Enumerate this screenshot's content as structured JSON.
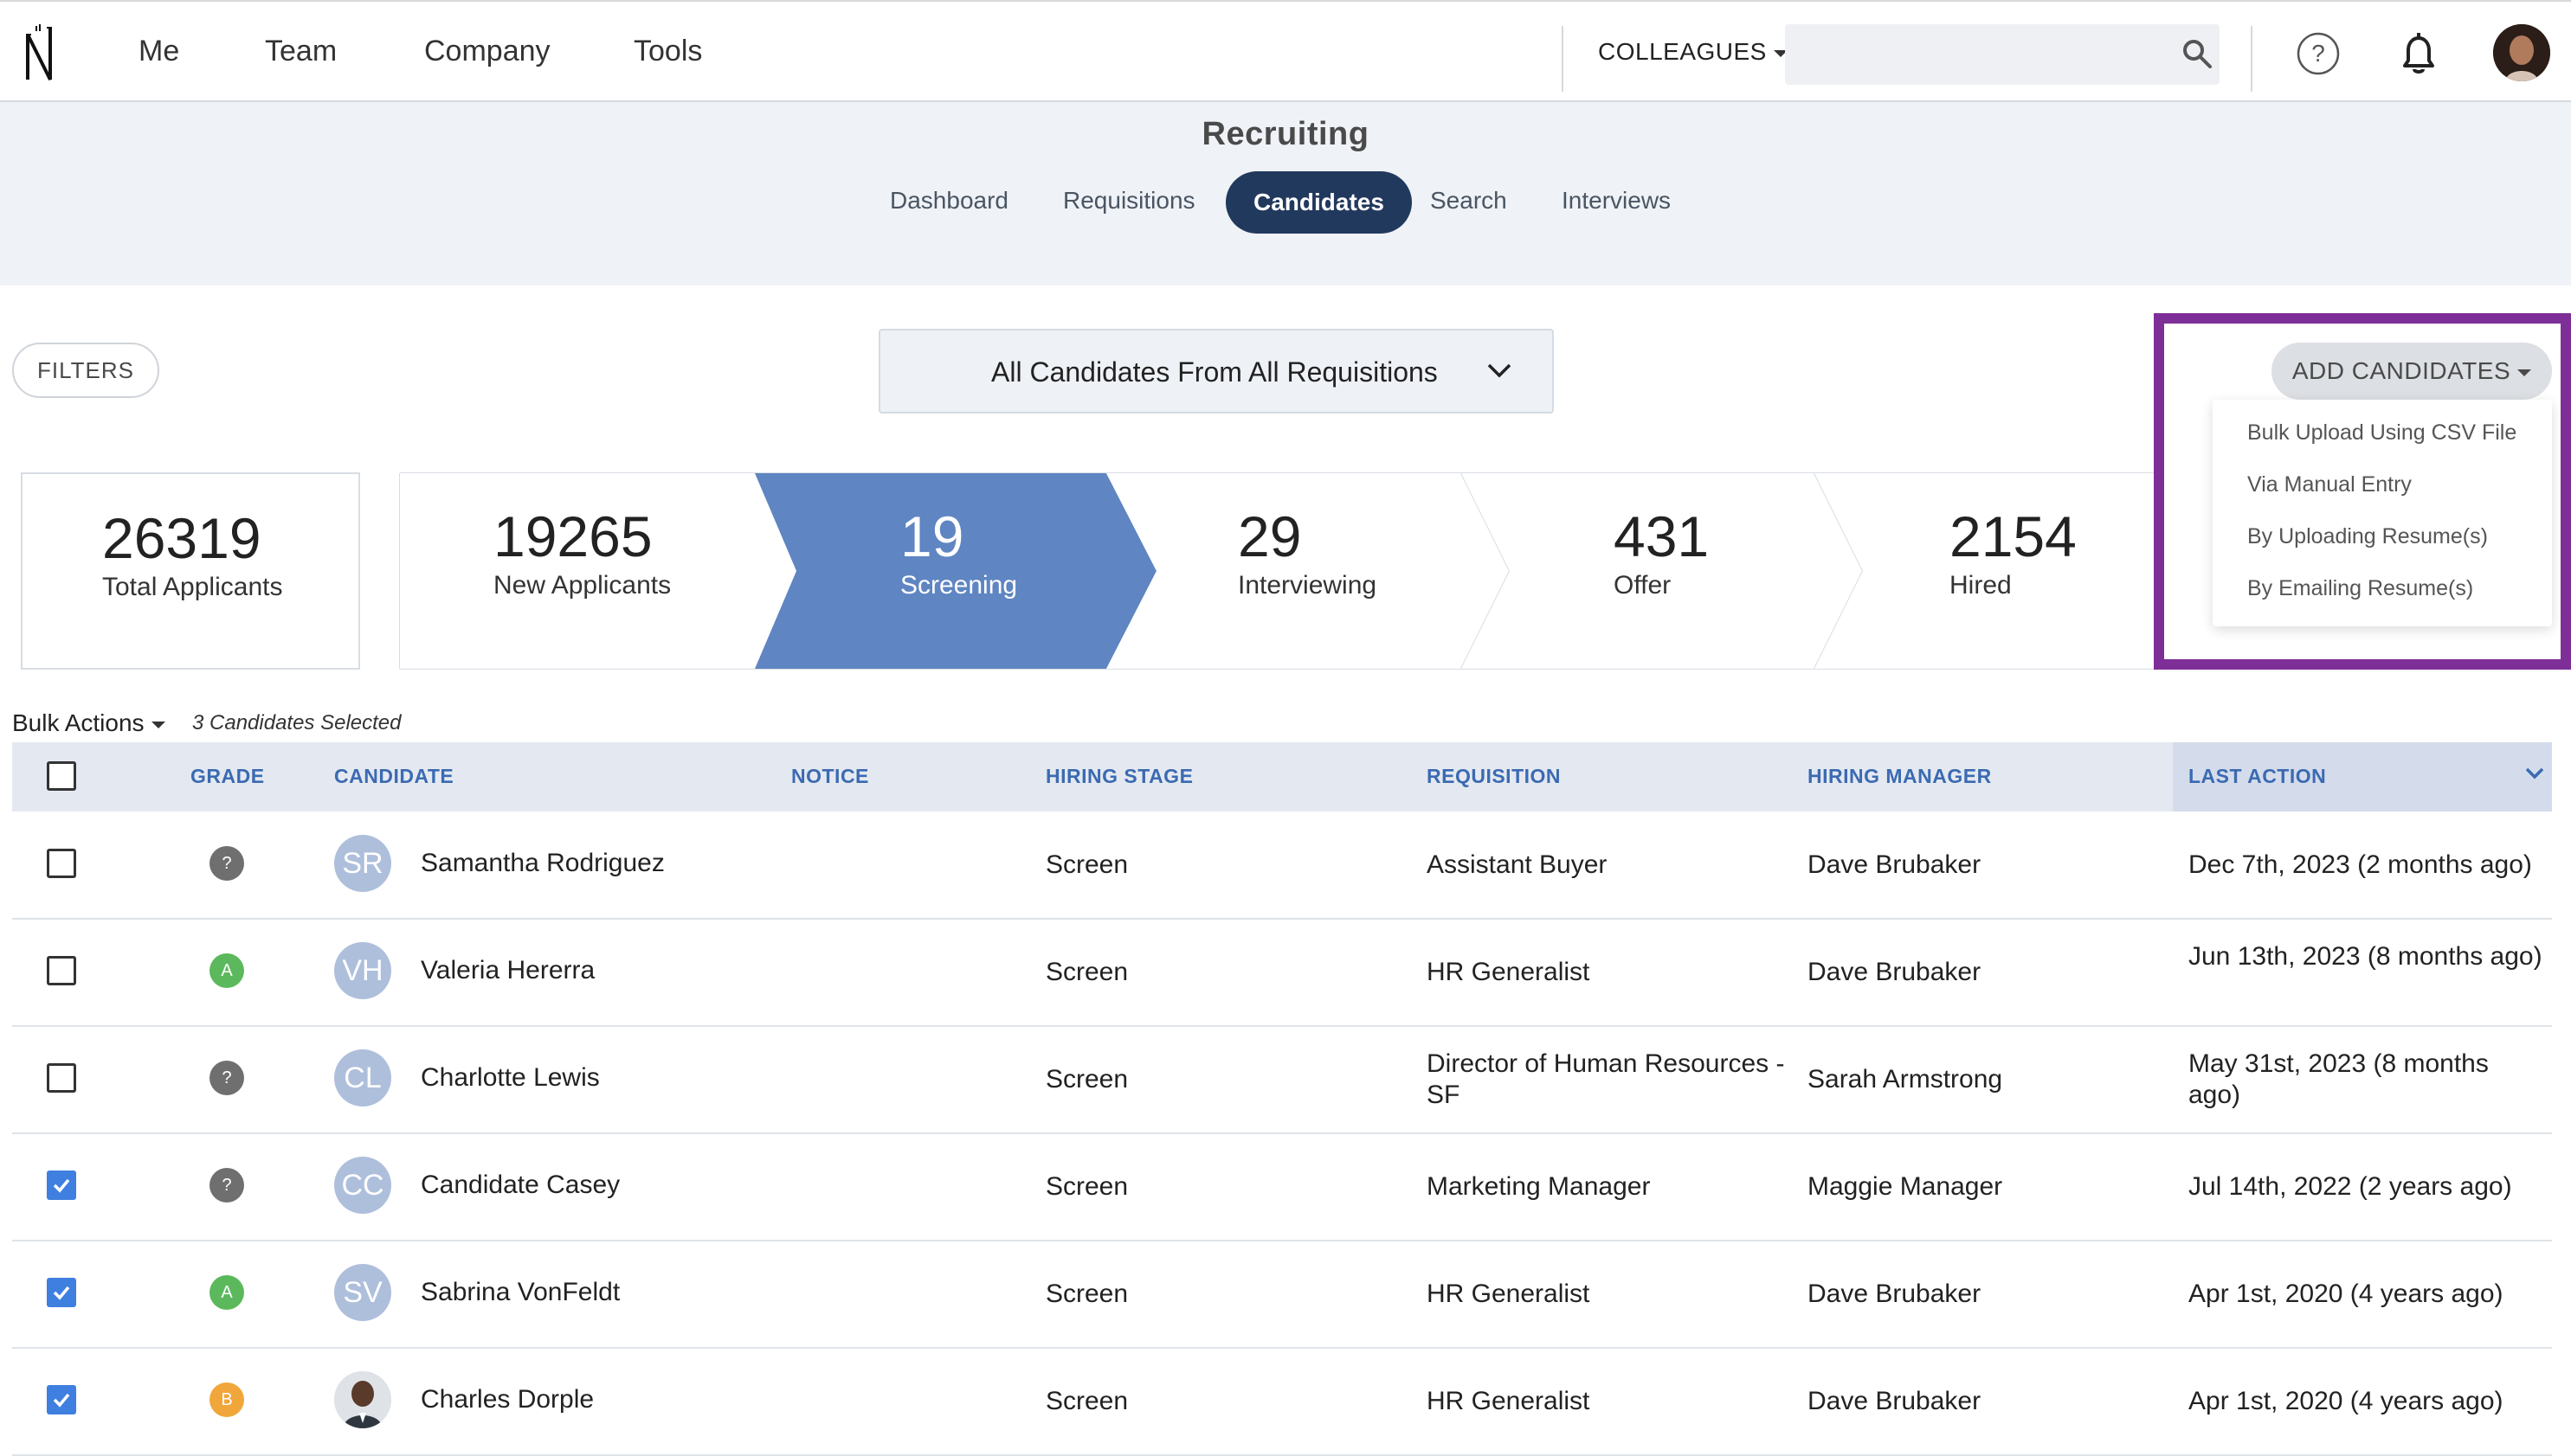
{
  "topnav": {
    "links": [
      "Me",
      "Team",
      "Company",
      "Tools"
    ],
    "colleagues_label": "COLLEAGUES",
    "search_placeholder": "",
    "help_glyph": "?"
  },
  "subnav": {
    "title": "Recruiting",
    "tabs": [
      {
        "label": "Dashboard"
      },
      {
        "label": "Requisitions"
      },
      {
        "label": "Candidates",
        "active": true
      },
      {
        "label": "Search"
      },
      {
        "label": "Interviews"
      }
    ]
  },
  "toolbar": {
    "filters_label": "FILTERS",
    "requisition_select": "All Candidates From All Requisitions",
    "add_candidates_label": "ADD CANDIDATES",
    "add_menu": [
      "Bulk Upload Using CSV File",
      "Via Manual Entry",
      "By Uploading Resume(s)",
      "By Emailing Resume(s)"
    ]
  },
  "stats": {
    "total": {
      "value": "26319",
      "label": "Total Applicants"
    },
    "stages": [
      {
        "value": "19265",
        "label": "New Applicants"
      },
      {
        "value": "19",
        "label": "Screening",
        "active": true
      },
      {
        "value": "29",
        "label": "Interviewing"
      },
      {
        "value": "431",
        "label": "Offer"
      },
      {
        "value": "2154",
        "label": "Hired"
      }
    ]
  },
  "table": {
    "bulk_actions_label": "Bulk Actions",
    "selected_note": "3 Candidates Selected",
    "headers": {
      "grade": "GRADE",
      "candidate": "CANDIDATE",
      "notice": "NOTICE",
      "hiring_stage": "HIRING STAGE",
      "requisition": "REQUISITION",
      "hiring_manager": "HIRING MANAGER",
      "last_action": "LAST ACTION"
    },
    "rows": [
      {
        "checked": false,
        "grade": "?",
        "grade_color": "#6f6f6f",
        "initials": "SR",
        "name": "Samantha Rodriguez",
        "notice": "",
        "stage": "Screen",
        "requisition": "Assistant Buyer",
        "manager": "Dave Brubaker",
        "last_action": "Dec 7th, 2023 (2 months ago)"
      },
      {
        "checked": false,
        "grade": "A",
        "grade_color": "#5cb85c",
        "initials": "VH",
        "name": "Valeria Hererra",
        "notice": "",
        "stage": "Screen",
        "requisition": "HR Generalist",
        "manager": "Dave Brubaker",
        "last_action": "Jun 13th, 2023 (8 months ago)"
      },
      {
        "checked": false,
        "grade": "?",
        "grade_color": "#6f6f6f",
        "initials": "CL",
        "name": "Charlotte Lewis",
        "notice": "",
        "stage": "Screen",
        "requisition": "Director of Human Resources - SF",
        "manager": "Sarah Armstrong",
        "last_action": "May 31st, 2023 (8 months ago)"
      },
      {
        "checked": true,
        "grade": "?",
        "grade_color": "#6f6f6f",
        "initials": "CC",
        "name": "Candidate Casey",
        "notice": "",
        "stage": "Screen",
        "requisition": "Marketing Manager",
        "manager": "Maggie Manager",
        "last_action": "Jul 14th, 2022 (2 years ago)"
      },
      {
        "checked": true,
        "grade": "A",
        "grade_color": "#5cb85c",
        "initials": "SV",
        "name": "Sabrina VonFeldt",
        "notice": "",
        "stage": "Screen",
        "requisition": "HR Generalist",
        "manager": "Dave Brubaker",
        "last_action": "Apr 1st, 2020 (4 years ago)"
      },
      {
        "checked": true,
        "grade": "B",
        "grade_color": "#f0a63a",
        "initials": "",
        "photo": true,
        "name": "Charles Dorple",
        "notice": "",
        "stage": "Screen",
        "requisition": "HR Generalist",
        "manager": "Dave Brubaker",
        "last_action": "Apr 1st, 2020 (4 years ago)"
      }
    ]
  },
  "colors": {
    "nav_dark": "#22395e",
    "pipeline_active": "#5f85c2",
    "highlight": "#7e2e97",
    "header_text": "#3b6ab2",
    "checkbox_checked": "#3f7fe0"
  },
  "icons": [
    "logo-icon",
    "caret-down-icon",
    "search-icon",
    "help-icon",
    "bell-icon",
    "chevron-down-icon",
    "check-icon"
  ]
}
